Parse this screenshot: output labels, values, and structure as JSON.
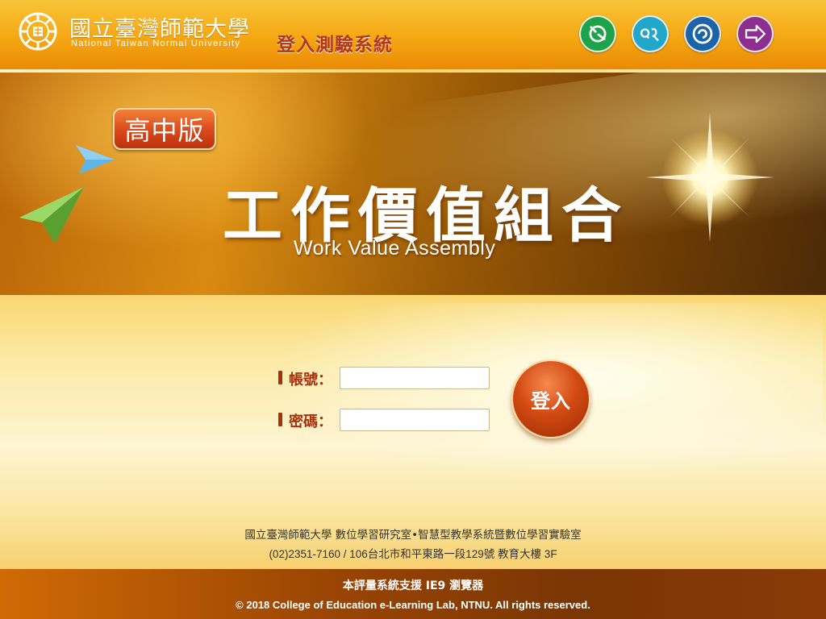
{
  "header": {
    "university_cn": "國立臺灣師範大學",
    "university_en": "National Taiwan Normal University",
    "nav_icons": [
      {
        "name": "green-cycle-icon",
        "color": "#1fa34a"
      },
      {
        "name": "teal-chat-icon",
        "color": "#21a7c9"
      },
      {
        "name": "blue-spiral-icon",
        "color": "#1c63a8"
      },
      {
        "name": "purple-arrow-icon",
        "color": "#8c2f8f"
      }
    ]
  },
  "banner": {
    "badge": "高中版",
    "title_cn": "工作價值組合",
    "title_en": "Work Value Assembly"
  },
  "login": {
    "title": "登入測驗系統",
    "account_label": "帳號：",
    "password_label": "密碼：",
    "account_value": "",
    "password_value": "",
    "submit_label": "登入"
  },
  "lab_info": {
    "line1": "國立臺灣師範大學 數位學習研究室•智慧型教學系統暨數位學習實驗室",
    "line2": "(02)2351-7160 / 106台北市和平東路一段129號 教育大樓 3F"
  },
  "footer": {
    "browser_note": "本評量系統支援 IE9 瀏覽器",
    "copyright": "© 2018 College of Education e-Learning Lab, NTNU. All rights reserved."
  },
  "colors": {
    "header_orange": "#f5a712",
    "banner_brown": "#9a5a06",
    "accent_red": "#a5320e",
    "footer_brown": "#7a3604"
  }
}
